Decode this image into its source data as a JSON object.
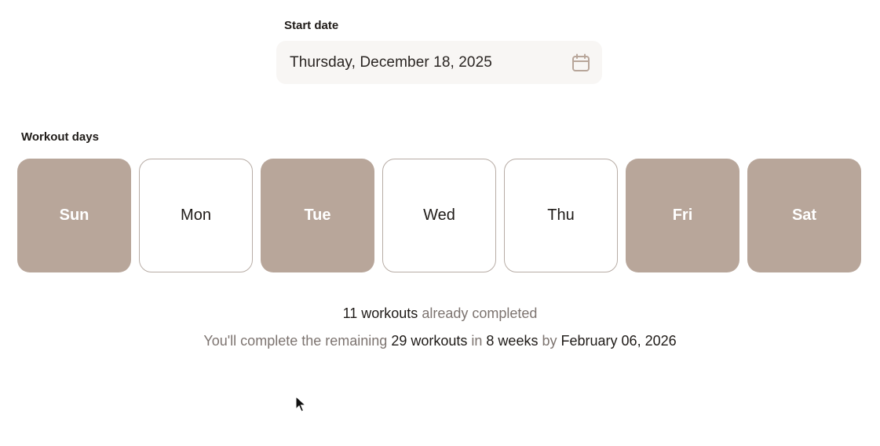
{
  "start_date": {
    "label": "Start date",
    "value": "Thursday, December 18, 2025",
    "icon": "calendar-icon"
  },
  "workout_days": {
    "label": "Workout days",
    "days": [
      {
        "label": "Sun",
        "selected": true
      },
      {
        "label": "Mon",
        "selected": false
      },
      {
        "label": "Tue",
        "selected": true
      },
      {
        "label": "Wed",
        "selected": false
      },
      {
        "label": "Thu",
        "selected": false
      },
      {
        "label": "Fri",
        "selected": true
      },
      {
        "label": "Sat",
        "selected": true
      }
    ]
  },
  "summary": {
    "completed_count": "11 workouts",
    "completed_text": "already completed",
    "prefix": "You'll complete the remaining",
    "remaining_count": "29 workouts",
    "in_word": "in",
    "duration": "8 weeks",
    "by_word": "by",
    "end_date": "February 06, 2026"
  },
  "colors": {
    "selected_day": "#b8a69a",
    "unselected_border": "#b7aca5",
    "date_field_bg": "#f8f6f4",
    "muted_text": "#7d7470"
  }
}
